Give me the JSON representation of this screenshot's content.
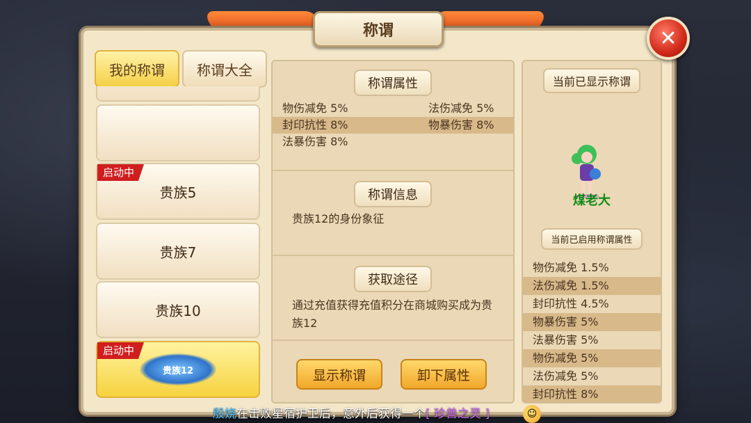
{
  "window": {
    "title": "称谓",
    "close_glyph": "✕"
  },
  "tabs": [
    {
      "label": "我的称谓",
      "active": true
    },
    {
      "label": "称谓大全",
      "active": false
    }
  ],
  "list": {
    "items": [
      {
        "label": "",
        "active_badge": ""
      },
      {
        "label": "贵族5",
        "active_badge": "启动中"
      },
      {
        "label": "贵族7",
        "active_badge": ""
      },
      {
        "label": "贵族10",
        "active_badge": ""
      },
      {
        "label": "贵族12",
        "active_badge": "启动中",
        "selected": true
      }
    ]
  },
  "attributes": {
    "heading": "称谓属性",
    "rows": [
      {
        "left": "物伤减免 5%",
        "right": "法伤减免 5%",
        "highlight": false
      },
      {
        "left": "封印抗性 8%",
        "right": "物暴伤害 8%",
        "highlight": true
      },
      {
        "left": "法暴伤害 8%",
        "right": "",
        "highlight": false
      }
    ]
  },
  "info": {
    "heading": "称谓信息",
    "text": "贵族12的身份象征"
  },
  "obtain": {
    "heading": "获取途径",
    "text": "通过充值获得充值积分在商城购买成为贵族12"
  },
  "buttons": {
    "show": "显示称谓",
    "remove": "卸下属性"
  },
  "current_display": {
    "heading": "当前已显示称谓",
    "character_name": "煤老大",
    "enabled_heading": "当前已启用称谓属性",
    "enabled_rows": [
      {
        "text": "物伤减免 1.5%",
        "highlight": false
      },
      {
        "text": "法伤减免 1.5%",
        "highlight": true
      },
      {
        "text": "封印抗性 4.5%",
        "highlight": false
      },
      {
        "text": "物暴伤害 5%",
        "highlight": true
      },
      {
        "text": "法暴伤害 5%",
        "highlight": false
      },
      {
        "text": "物伤减免 5%",
        "highlight": true
      },
      {
        "text": "法伤减免 5%",
        "highlight": false
      },
      {
        "text": "封印抗性 8%",
        "highlight": true
      }
    ]
  },
  "ticker": {
    "player": "殷娆",
    "text": "在击败星宿护卫后，意外后获得一个",
    "item": "[ 珍兽之灵 ]"
  },
  "colors": {
    "accent_orange": "#f1a72b",
    "panel_bg": "#f4e7c9",
    "active_badge": "#d01e1e",
    "name_green": "#0f8a16"
  }
}
